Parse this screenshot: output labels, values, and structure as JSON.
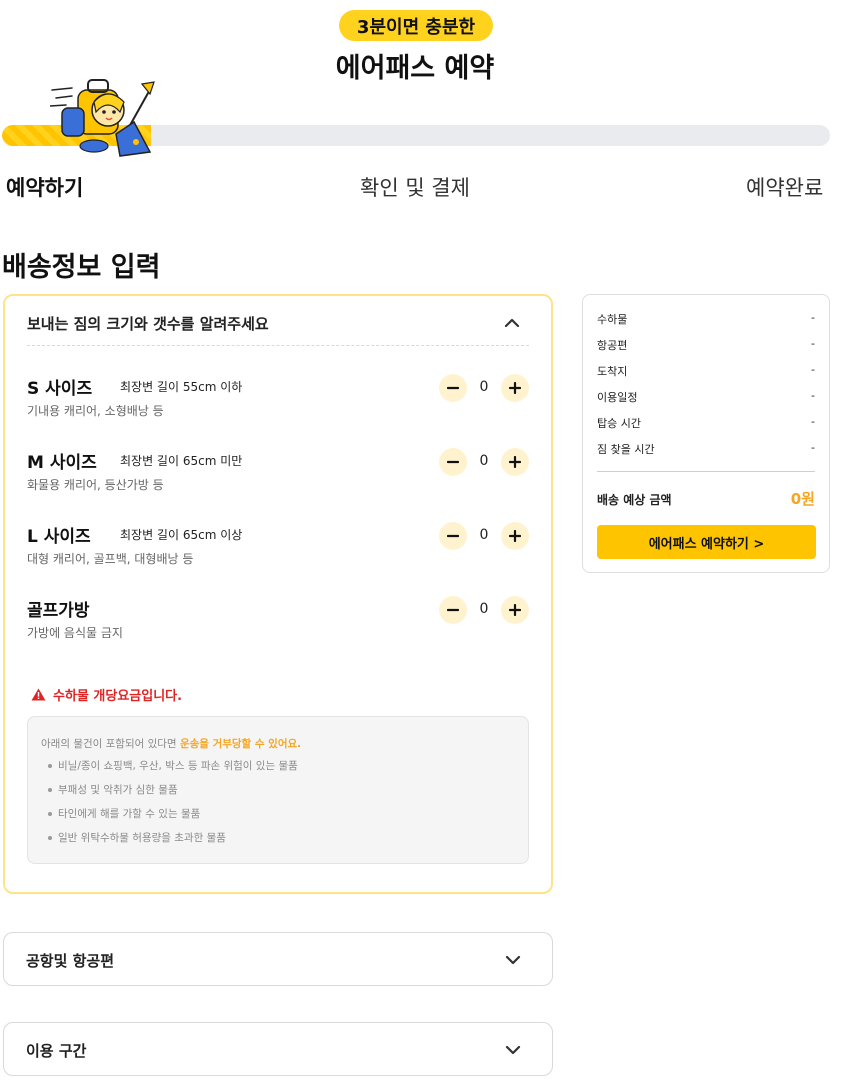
{
  "hero": {
    "badge": "3분이면 충분한",
    "title": "에어패스 예약"
  },
  "progress": {
    "fraction": 0.18,
    "mascot_icon": "mascot-traveler-icon"
  },
  "steps": [
    {
      "label": "예약하기",
      "active": true
    },
    {
      "label": "확인 및 결제",
      "active": false
    },
    {
      "label": "예약완료",
      "active": false
    }
  ],
  "section_title": "배송정보 입력",
  "luggage": {
    "heading": "보내는 짐의 크기와 갯수를 알려주세요",
    "collapse_icon": "chevron-up-icon",
    "items": [
      {
        "name": "S 사이즈",
        "spec": "최장변 길이 55cm 이하",
        "desc": "기내용 캐리어, 소형배낭 등",
        "qty": "0"
      },
      {
        "name": "M 사이즈",
        "spec": "최장변 길이 65cm 미만",
        "desc": "화물용 캐리어, 등산가방 등",
        "qty": "0"
      },
      {
        "name": "L 사이즈",
        "spec": "최장변 길이 65cm 이상",
        "desc": "대형 캐리어, 골프백, 대형배낭 등",
        "qty": "0"
      },
      {
        "name": "골프가방",
        "spec": "",
        "desc": "가방에 음식물 금지",
        "qty": "0"
      }
    ],
    "warning": "수하물 개당요금입니다.",
    "notice": {
      "lead": "아래의 물건이 포함되어 있다면 ",
      "lead_highlight": "운송을 거부당할 수 있어요.",
      "bullets": [
        "비닐/종이 쇼핑백, 우산, 박스 등 파손 위험이 있는 물품",
        "부패성 및 악취가 심한 물품",
        "타인에게 해를 가할 수 있는 물품",
        "일반 위탁수하물 허용량을 초과한 물품"
      ]
    }
  },
  "collapsed_sections": [
    {
      "label": "공항및 항공편",
      "icon": "chevron-down-icon"
    },
    {
      "label": "이용 구간",
      "icon": "chevron-down-icon"
    }
  ],
  "summary": {
    "rows": [
      {
        "key": "수하물",
        "value": "-"
      },
      {
        "key": "항공편",
        "value": "-"
      },
      {
        "key": "도착지",
        "value": "-"
      },
      {
        "key": "이용일정",
        "value": "-"
      },
      {
        "key": "탑승 시간",
        "value": "-"
      },
      {
        "key": "짐 찾을 시간",
        "value": "-"
      }
    ],
    "total_label": "배송 예상 금액",
    "total_value": "0원",
    "cta_label": "에어패스 예약하기 >"
  },
  "colors": {
    "accent": "#ffc400",
    "badge": "#ffd21e",
    "price": "#f5a623",
    "warning": "#e02424"
  }
}
